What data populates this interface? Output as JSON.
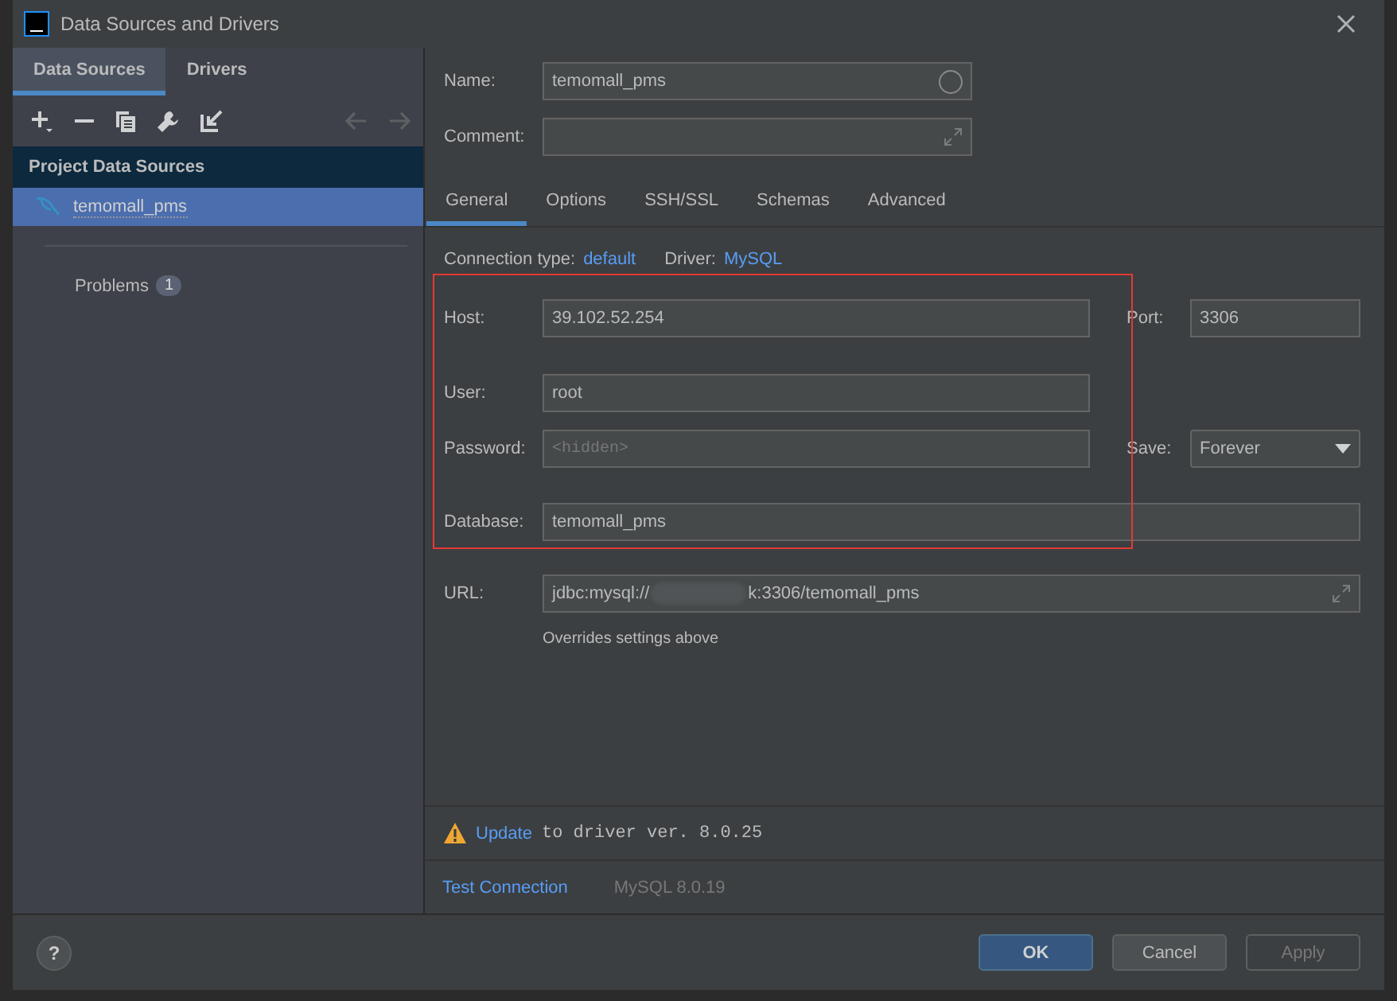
{
  "window": {
    "title": "Data Sources and Drivers"
  },
  "left_tabs": [
    {
      "label": "Data Sources",
      "selected": true
    },
    {
      "label": "Drivers",
      "selected": false
    }
  ],
  "sidebar": {
    "header": "Project Data Sources",
    "items": [
      {
        "label": "temomall_pms",
        "selected": true
      }
    ],
    "problems": {
      "label": "Problems",
      "count": "1"
    }
  },
  "name": {
    "label": "Name:",
    "value": "temomall_pms"
  },
  "comment": {
    "label": "Comment:"
  },
  "tabs": [
    {
      "label": "General",
      "selected": true
    },
    {
      "label": "Options",
      "selected": false
    },
    {
      "label": "SSH/SSL",
      "selected": false
    },
    {
      "label": "Schemas",
      "selected": false
    },
    {
      "label": "Advanced",
      "selected": false
    }
  ],
  "connection": {
    "type_label": "Connection type:",
    "type": "default",
    "driver_label": "Driver:",
    "driver": "MySQL"
  },
  "host": {
    "label": "Host:",
    "value": "39.102.52.254"
  },
  "port": {
    "label": "Port:",
    "value": "3306"
  },
  "user": {
    "label": "User:",
    "value": "root"
  },
  "password": {
    "label": "Password:",
    "placeholder": "<hidden>"
  },
  "save": {
    "label": "Save:",
    "value": "Forever"
  },
  "database": {
    "label": "Database:",
    "value": "temomall_pms"
  },
  "url": {
    "label": "URL:",
    "value_start": "jdbc:mysql://",
    "value_end": "k:3306/temomall_pms",
    "note": "Overrides settings above"
  },
  "warning": {
    "link": "Update",
    "text": "to driver ver. 8.0.25"
  },
  "test": {
    "link": "Test Connection",
    "driver_version": "MySQL 8.0.19"
  },
  "buttons": [
    {
      "label": "OK",
      "kind": "primary",
      "disabled": false
    },
    {
      "label": "Cancel",
      "kind": "normal",
      "disabled": false
    },
    {
      "label": "Apply",
      "kind": "normal",
      "disabled": true
    }
  ],
  "help": "?"
}
